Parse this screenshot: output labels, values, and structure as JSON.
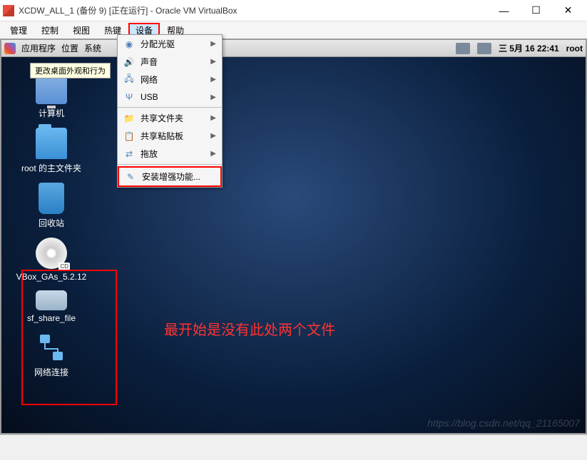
{
  "window": {
    "title": "XCDW_ALL_1 (备份 9) [正在运行] - Oracle VM VirtualBox"
  },
  "menubar": {
    "items": [
      "管理",
      "控制",
      "视图",
      "热键",
      "设备",
      "帮助"
    ],
    "active_index": 4
  },
  "dropdown": {
    "items": [
      {
        "icon": "disc",
        "label": "分配光驱",
        "arrow": true
      },
      {
        "icon": "sound",
        "label": "声音",
        "arrow": true
      },
      {
        "icon": "network",
        "label": "网络",
        "arrow": true
      },
      {
        "icon": "usb",
        "label": "USB",
        "arrow": true
      },
      {
        "sep": true
      },
      {
        "icon": "folder",
        "label": "共享文件夹",
        "arrow": true
      },
      {
        "icon": "clipboard",
        "label": "共享粘贴板",
        "arrow": true
      },
      {
        "icon": "drag",
        "label": "拖放",
        "arrow": true
      },
      {
        "sep": true
      },
      {
        "icon": "install",
        "label": "安装增强功能...",
        "arrow": false,
        "highlighted": true
      }
    ]
  },
  "tooltip": "更改桌面外观和行为",
  "vm_topbar": {
    "apps": "应用程序",
    "location": "位置",
    "system": "系统",
    "datetime": "三  5月 16 22:41",
    "user": "root"
  },
  "desktop": {
    "icons": [
      {
        "type": "computer",
        "label": "计算机"
      },
      {
        "type": "folder",
        "label": "root 的主文件夹"
      },
      {
        "type": "trash",
        "label": "回收站"
      },
      {
        "type": "cd",
        "label": "VBox_GAs_5.2.12"
      },
      {
        "type": "drive",
        "label": "sf_share_file"
      },
      {
        "type": "network",
        "label": "网络连接"
      }
    ]
  },
  "annotation": "最开始是没有此处两个文件",
  "watermark": "https://blog.csdn.net/qq_21165007",
  "statusbar": ""
}
